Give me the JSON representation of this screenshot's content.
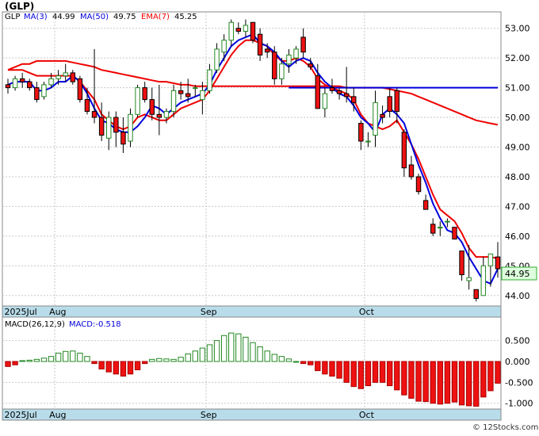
{
  "chart_data": [
    {
      "type": "candlestick",
      "title": "(GLP)",
      "legend": {
        "ticker": "GLP",
        "ma3_label": "MA(3)",
        "ma3_value": "44.99",
        "ma50_label": "MA(50)",
        "ma50_value": "49.75",
        "ema7_label": "EMA(7)",
        "ema7_value": "45.25"
      },
      "last_price_label": "44.95",
      "ylim": [
        43.7,
        53.5
      ],
      "y_ticks": [
        "44.00",
        "45.00",
        "46.00",
        "47.00",
        "48.00",
        "49.00",
        "50.00",
        "51.00",
        "52.00",
        "53.00"
      ],
      "x_labels": [
        {
          "label": "2025Jul",
          "index": -0.5
        },
        {
          "label": "Aug",
          "index": 6.5
        },
        {
          "label": "Sep",
          "index": 27.5
        },
        {
          "label": "Oct",
          "index": 49.5
        }
      ],
      "candles": [
        [
          51.1,
          51.3,
          50.8,
          51.0
        ],
        [
          51.0,
          51.4,
          50.9,
          51.3
        ],
        [
          51.3,
          51.5,
          51.0,
          51.2
        ],
        [
          51.2,
          51.3,
          50.9,
          51.0
        ],
        [
          51.0,
          51.2,
          50.5,
          50.6
        ],
        [
          50.7,
          51.2,
          50.6,
          51.1
        ],
        [
          51.1,
          51.5,
          51.0,
          51.3
        ],
        [
          51.3,
          51.6,
          51.1,
          51.4
        ],
        [
          51.4,
          51.8,
          51.2,
          51.5
        ],
        [
          51.5,
          51.6,
          51.1,
          51.2
        ],
        [
          51.3,
          51.4,
          50.5,
          50.6
        ],
        [
          50.6,
          51.0,
          50.1,
          50.2
        ],
        [
          50.2,
          52.3,
          49.8,
          50.0
        ],
        [
          50.0,
          50.5,
          49.2,
          49.4
        ],
        [
          49.3,
          50.2,
          48.9,
          50.0
        ],
        [
          50.0,
          50.2,
          49.0,
          49.5
        ],
        [
          49.5,
          50.0,
          48.8,
          49.1
        ],
        [
          49.2,
          50.3,
          49.0,
          50.1
        ],
        [
          50.1,
          51.1,
          50.0,
          51.0
        ],
        [
          51.0,
          51.2,
          50.5,
          50.6
        ],
        [
          50.6,
          51.0,
          49.9,
          50.1
        ],
        [
          50.1,
          51.1,
          49.4,
          50.0
        ],
        [
          50.0,
          50.3,
          49.8,
          50.2
        ],
        [
          50.2,
          51.1,
          50.0,
          50.9
        ],
        [
          50.9,
          51.2,
          50.6,
          50.8
        ],
        [
          50.8,
          51.3,
          50.5,
          50.7
        ],
        [
          51.0,
          51.1,
          50.7,
          51.0
        ],
        [
          50.6,
          51.2,
          50.1,
          50.9
        ],
        [
          50.9,
          51.8,
          50.8,
          51.6
        ],
        [
          51.6,
          52.5,
          51.5,
          52.3
        ],
        [
          52.2,
          52.8,
          51.9,
          52.6
        ],
        [
          52.6,
          53.3,
          52.4,
          53.2
        ],
        [
          53.0,
          53.2,
          52.8,
          52.9
        ],
        [
          52.9,
          53.3,
          52.7,
          53.1
        ],
        [
          53.2,
          53.2,
          52.5,
          52.6
        ],
        [
          52.8,
          53.0,
          51.9,
          52.1
        ],
        [
          52.3,
          52.5,
          52.0,
          52.2
        ],
        [
          52.2,
          52.4,
          51.1,
          51.3
        ],
        [
          51.3,
          52.0,
          51.1,
          51.8
        ],
        [
          51.8,
          52.3,
          51.5,
          52.1
        ],
        [
          52.0,
          52.4,
          51.8,
          52.3
        ],
        [
          52.7,
          53.0,
          52.0,
          52.2
        ],
        [
          51.8,
          52.0,
          51.6,
          51.7
        ],
        [
          51.4,
          51.8,
          50.3,
          50.3
        ],
        [
          50.3,
          51.0,
          50.0,
          50.8
        ],
        [
          51.0,
          51.3,
          50.8,
          50.9
        ],
        [
          50.9,
          51.0,
          50.6,
          50.8
        ],
        [
          50.8,
          51.7,
          50.5,
          50.7
        ],
        [
          50.7,
          51.0,
          50.2,
          50.5
        ],
        [
          49.8,
          49.9,
          48.9,
          49.2
        ],
        [
          49.2,
          49.5,
          49.0,
          49.2
        ],
        [
          49.4,
          50.9,
          49.0,
          50.5
        ],
        [
          50.1,
          50.4,
          49.8,
          50.0
        ],
        [
          50.7,
          51.0,
          50.0,
          50.2
        ],
        [
          50.9,
          51.0,
          49.8,
          50.2
        ],
        [
          49.5,
          49.6,
          48.0,
          48.3
        ],
        [
          48.4,
          48.7,
          47.9,
          48.0
        ],
        [
          48.0,
          48.1,
          47.4,
          47.5
        ],
        [
          47.2,
          47.4,
          46.9,
          46.9
        ],
        [
          46.4,
          46.6,
          46.0,
          46.1
        ],
        [
          46.3,
          46.5,
          46.0,
          46.3
        ],
        [
          46.5,
          46.6,
          46.3,
          46.5
        ],
        [
          46.3,
          46.3,
          45.9,
          45.9
        ],
        [
          45.5,
          45.5,
          44.5,
          44.7
        ],
        [
          44.5,
          45.7,
          44.2,
          44.6
        ],
        [
          44.2,
          44.2,
          43.8,
          43.9
        ],
        [
          44.0,
          45.3,
          44.0,
          45.0
        ],
        [
          45.0,
          45.3,
          44.3,
          45.4
        ],
        [
          45.3,
          45.8,
          44.6,
          44.9
        ]
      ],
      "series": [
        {
          "name": "MA(3)",
          "color": "#0000dd",
          "values": [
            51.1,
            51.2,
            51.2,
            51.2,
            50.9,
            50.9,
            51.0,
            51.2,
            51.2,
            51.4,
            51.2,
            50.8,
            50.3,
            49.9,
            49.8,
            49.6,
            49.5,
            49.5,
            49.7,
            50.0,
            50.4,
            50.3,
            50.1,
            50.3,
            50.5,
            50.6,
            50.7,
            50.8,
            51.1,
            51.6,
            52.0,
            52.4,
            52.6,
            52.7,
            52.8,
            52.5,
            52.4,
            52.2,
            51.9,
            51.7,
            51.9,
            52.0,
            51.9,
            51.5,
            51.2,
            51.0,
            50.8,
            50.7,
            50.4,
            50.0,
            49.8,
            49.5,
            50.1,
            50.3,
            50.1,
            49.8,
            49.1,
            48.4,
            47.8,
            47.1,
            46.6,
            46.2,
            46.1,
            45.8,
            45.3,
            44.9,
            44.5,
            44.4,
            44.9
          ]
        },
        {
          "name": "MA(50)",
          "color": "#0000dd",
          "values": [
            null,
            null,
            null,
            null,
            null,
            null,
            null,
            null,
            null,
            null,
            null,
            null,
            null,
            null,
            null,
            null,
            null,
            null,
            null,
            null,
            null,
            null,
            null,
            null,
            null,
            null,
            null,
            null,
            null,
            null,
            null,
            null,
            null,
            null,
            null,
            null,
            null,
            null,
            null,
            51.0,
            51.0,
            51.0,
            51.0,
            51.0,
            51.0,
            51.0,
            51.0,
            51.0,
            51.0,
            51.0,
            51.0,
            51.0,
            51.0,
            51.0,
            51.0,
            51.0,
            51.0,
            51.0,
            51.0,
            51.0,
            51.0,
            51.0,
            51.0,
            51.0,
            51.0,
            51.0,
            51.0,
            51.0,
            51.0
          ]
        },
        {
          "name": "EMA(7)",
          "color": "#ee0000",
          "values": [
            51.6,
            51.6,
            51.6,
            51.5,
            51.4,
            51.4,
            51.4,
            51.4,
            51.4,
            51.4,
            51.2,
            50.9,
            50.6,
            50.1,
            49.9,
            49.7,
            49.6,
            49.7,
            50.0,
            50.1,
            50.0,
            49.9,
            49.9,
            50.1,
            50.3,
            50.4,
            50.5,
            50.6,
            50.9,
            51.3,
            51.7,
            52.1,
            52.4,
            52.6,
            52.6,
            52.5,
            52.4,
            52.1,
            51.9,
            51.9,
            52.0,
            51.9,
            51.7,
            51.3,
            51.1,
            51.0,
            50.9,
            50.8,
            50.6,
            50.1,
            49.8,
            49.7,
            49.6,
            49.7,
            49.9,
            49.5,
            49.1,
            48.6,
            48.0,
            47.4,
            46.9,
            46.7,
            46.5,
            46.1,
            45.6,
            45.3,
            45.3,
            45.3,
            45.25
          ]
        },
        {
          "name": "MA(50) long",
          "color": "#ee0000",
          "values": [
            51.6,
            51.7,
            51.8,
            51.8,
            51.9,
            51.9,
            51.9,
            51.9,
            51.9,
            51.85,
            51.8,
            51.75,
            51.7,
            51.6,
            51.55,
            51.5,
            51.45,
            51.4,
            51.35,
            51.3,
            51.25,
            51.2,
            51.2,
            51.15,
            51.1,
            51.1,
            51.05,
            51.05,
            51.05,
            51.05,
            51.05,
            51.05,
            51.05,
            51.05,
            51.05,
            51.05,
            51.05,
            51.05,
            51.05,
            51.05,
            51.05,
            51.05,
            51.05,
            51.05,
            51.05,
            51.05,
            51.05,
            51.0,
            51.0,
            51.0,
            51.0,
            51.0,
            51.0,
            50.95,
            50.9,
            50.85,
            50.8,
            50.7,
            50.6,
            50.5,
            50.4,
            50.3,
            50.2,
            50.1,
            50.0,
            49.9,
            49.85,
            49.8,
            49.75
          ]
        }
      ]
    },
    {
      "type": "bar",
      "legend": {
        "label": "MACD(26,12,9)",
        "value_label": "MACD:-0.518"
      },
      "ylim": [
        -1.1,
        0.72
      ],
      "y_ticks": [
        "0.500",
        "0.000",
        "-0.500",
        "-1.000"
      ],
      "x_labels": [
        {
          "label": "2025Jul",
          "index": -0.5
        },
        {
          "label": "Aug",
          "index": 6.5
        },
        {
          "label": "Sep",
          "index": 27.5
        },
        {
          "label": "Oct",
          "index": 49.5
        }
      ],
      "values": [
        -0.12,
        -0.08,
        0.02,
        0.03,
        0.05,
        0.08,
        0.12,
        0.2,
        0.24,
        0.25,
        0.2,
        0.12,
        -0.05,
        -0.18,
        -0.25,
        -0.3,
        -0.35,
        -0.3,
        -0.2,
        -0.05,
        0.05,
        0.07,
        0.06,
        0.05,
        0.1,
        0.18,
        0.25,
        0.32,
        0.4,
        0.5,
        0.62,
        0.68,
        0.66,
        0.58,
        0.45,
        0.35,
        0.25,
        0.17,
        0.12,
        0.06,
        0.0,
        -0.05,
        -0.08,
        -0.22,
        -0.3,
        -0.35,
        -0.4,
        -0.5,
        -0.6,
        -0.65,
        -0.58,
        -0.5,
        -0.5,
        -0.58,
        -0.68,
        -0.8,
        -0.88,
        -0.95,
        -0.96,
        -1.0,
        -1.02,
        -1.0,
        -0.97,
        -1.04,
        -1.06,
        -1.07,
        -0.85,
        -0.7,
        -0.52
      ]
    }
  ],
  "watermark": "© 12Stocks.com"
}
